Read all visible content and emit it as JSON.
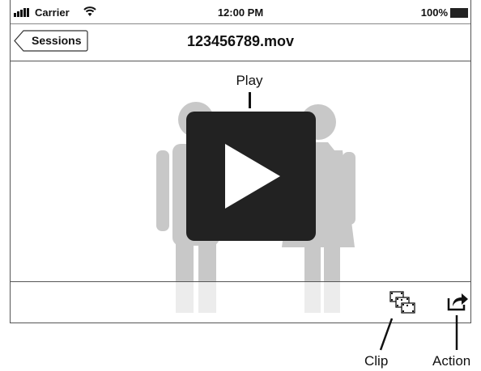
{
  "status_bar": {
    "carrier": "Carrier",
    "time": "12:00 PM",
    "battery": "100%"
  },
  "nav": {
    "back_label": "Sessions",
    "title": "123456789.mov"
  },
  "annotations": {
    "play": "Play",
    "clip": "Clip",
    "action": "Action"
  },
  "icons": {
    "signal": "signal-bars-icon",
    "wifi": "wifi-icon",
    "battery": "battery-icon",
    "back": "chevron-left-icon",
    "play": "play-icon",
    "clip": "film-frames-icon",
    "action": "share-arrow-icon"
  }
}
